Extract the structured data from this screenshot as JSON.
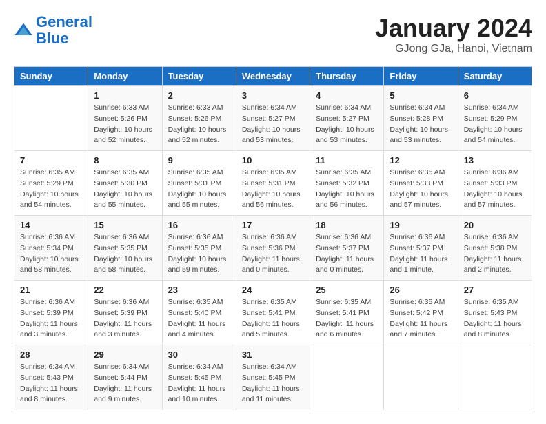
{
  "logo": {
    "line1": "General",
    "line2": "Blue"
  },
  "title": "January 2024",
  "subtitle": "GJong GJa, Hanoi, Vietnam",
  "days_of_week": [
    "Sunday",
    "Monday",
    "Tuesday",
    "Wednesday",
    "Thursday",
    "Friday",
    "Saturday"
  ],
  "weeks": [
    [
      {
        "day": "",
        "sunrise": "",
        "sunset": "",
        "daylight": ""
      },
      {
        "day": "1",
        "sunrise": "Sunrise: 6:33 AM",
        "sunset": "Sunset: 5:26 PM",
        "daylight": "Daylight: 10 hours and 52 minutes."
      },
      {
        "day": "2",
        "sunrise": "Sunrise: 6:33 AM",
        "sunset": "Sunset: 5:26 PM",
        "daylight": "Daylight: 10 hours and 52 minutes."
      },
      {
        "day": "3",
        "sunrise": "Sunrise: 6:34 AM",
        "sunset": "Sunset: 5:27 PM",
        "daylight": "Daylight: 10 hours and 53 minutes."
      },
      {
        "day": "4",
        "sunrise": "Sunrise: 6:34 AM",
        "sunset": "Sunset: 5:27 PM",
        "daylight": "Daylight: 10 hours and 53 minutes."
      },
      {
        "day": "5",
        "sunrise": "Sunrise: 6:34 AM",
        "sunset": "Sunset: 5:28 PM",
        "daylight": "Daylight: 10 hours and 53 minutes."
      },
      {
        "day": "6",
        "sunrise": "Sunrise: 6:34 AM",
        "sunset": "Sunset: 5:29 PM",
        "daylight": "Daylight: 10 hours and 54 minutes."
      }
    ],
    [
      {
        "day": "7",
        "sunrise": "Sunrise: 6:35 AM",
        "sunset": "Sunset: 5:29 PM",
        "daylight": "Daylight: 10 hours and 54 minutes."
      },
      {
        "day": "8",
        "sunrise": "Sunrise: 6:35 AM",
        "sunset": "Sunset: 5:30 PM",
        "daylight": "Daylight: 10 hours and 55 minutes."
      },
      {
        "day": "9",
        "sunrise": "Sunrise: 6:35 AM",
        "sunset": "Sunset: 5:31 PM",
        "daylight": "Daylight: 10 hours and 55 minutes."
      },
      {
        "day": "10",
        "sunrise": "Sunrise: 6:35 AM",
        "sunset": "Sunset: 5:31 PM",
        "daylight": "Daylight: 10 hours and 56 minutes."
      },
      {
        "day": "11",
        "sunrise": "Sunrise: 6:35 AM",
        "sunset": "Sunset: 5:32 PM",
        "daylight": "Daylight: 10 hours and 56 minutes."
      },
      {
        "day": "12",
        "sunrise": "Sunrise: 6:35 AM",
        "sunset": "Sunset: 5:33 PM",
        "daylight": "Daylight: 10 hours and 57 minutes."
      },
      {
        "day": "13",
        "sunrise": "Sunrise: 6:36 AM",
        "sunset": "Sunset: 5:33 PM",
        "daylight": "Daylight: 10 hours and 57 minutes."
      }
    ],
    [
      {
        "day": "14",
        "sunrise": "Sunrise: 6:36 AM",
        "sunset": "Sunset: 5:34 PM",
        "daylight": "Daylight: 10 hours and 58 minutes."
      },
      {
        "day": "15",
        "sunrise": "Sunrise: 6:36 AM",
        "sunset": "Sunset: 5:35 PM",
        "daylight": "Daylight: 10 hours and 58 minutes."
      },
      {
        "day": "16",
        "sunrise": "Sunrise: 6:36 AM",
        "sunset": "Sunset: 5:35 PM",
        "daylight": "Daylight: 10 hours and 59 minutes."
      },
      {
        "day": "17",
        "sunrise": "Sunrise: 6:36 AM",
        "sunset": "Sunset: 5:36 PM",
        "daylight": "Daylight: 11 hours and 0 minutes."
      },
      {
        "day": "18",
        "sunrise": "Sunrise: 6:36 AM",
        "sunset": "Sunset: 5:37 PM",
        "daylight": "Daylight: 11 hours and 0 minutes."
      },
      {
        "day": "19",
        "sunrise": "Sunrise: 6:36 AM",
        "sunset": "Sunset: 5:37 PM",
        "daylight": "Daylight: 11 hours and 1 minute."
      },
      {
        "day": "20",
        "sunrise": "Sunrise: 6:36 AM",
        "sunset": "Sunset: 5:38 PM",
        "daylight": "Daylight: 11 hours and 2 minutes."
      }
    ],
    [
      {
        "day": "21",
        "sunrise": "Sunrise: 6:36 AM",
        "sunset": "Sunset: 5:39 PM",
        "daylight": "Daylight: 11 hours and 3 minutes."
      },
      {
        "day": "22",
        "sunrise": "Sunrise: 6:36 AM",
        "sunset": "Sunset: 5:39 PM",
        "daylight": "Daylight: 11 hours and 3 minutes."
      },
      {
        "day": "23",
        "sunrise": "Sunrise: 6:35 AM",
        "sunset": "Sunset: 5:40 PM",
        "daylight": "Daylight: 11 hours and 4 minutes."
      },
      {
        "day": "24",
        "sunrise": "Sunrise: 6:35 AM",
        "sunset": "Sunset: 5:41 PM",
        "daylight": "Daylight: 11 hours and 5 minutes."
      },
      {
        "day": "25",
        "sunrise": "Sunrise: 6:35 AM",
        "sunset": "Sunset: 5:41 PM",
        "daylight": "Daylight: 11 hours and 6 minutes."
      },
      {
        "day": "26",
        "sunrise": "Sunrise: 6:35 AM",
        "sunset": "Sunset: 5:42 PM",
        "daylight": "Daylight: 11 hours and 7 minutes."
      },
      {
        "day": "27",
        "sunrise": "Sunrise: 6:35 AM",
        "sunset": "Sunset: 5:43 PM",
        "daylight": "Daylight: 11 hours and 8 minutes."
      }
    ],
    [
      {
        "day": "28",
        "sunrise": "Sunrise: 6:34 AM",
        "sunset": "Sunset: 5:43 PM",
        "daylight": "Daylight: 11 hours and 8 minutes."
      },
      {
        "day": "29",
        "sunrise": "Sunrise: 6:34 AM",
        "sunset": "Sunset: 5:44 PM",
        "daylight": "Daylight: 11 hours and 9 minutes."
      },
      {
        "day": "30",
        "sunrise": "Sunrise: 6:34 AM",
        "sunset": "Sunset: 5:45 PM",
        "daylight": "Daylight: 11 hours and 10 minutes."
      },
      {
        "day": "31",
        "sunrise": "Sunrise: 6:34 AM",
        "sunset": "Sunset: 5:45 PM",
        "daylight": "Daylight: 11 hours and 11 minutes."
      },
      {
        "day": "",
        "sunrise": "",
        "sunset": "",
        "daylight": ""
      },
      {
        "day": "",
        "sunrise": "",
        "sunset": "",
        "daylight": ""
      },
      {
        "day": "",
        "sunrise": "",
        "sunset": "",
        "daylight": ""
      }
    ]
  ]
}
